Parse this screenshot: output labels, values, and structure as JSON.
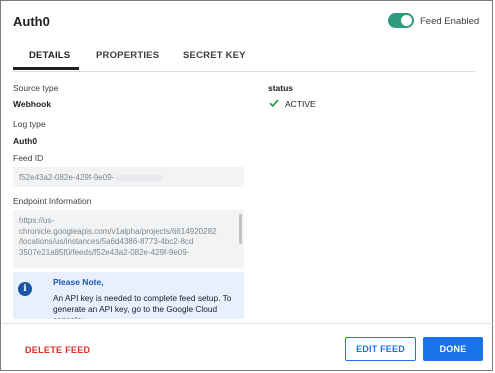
{
  "dialog": {
    "title": "Auth0",
    "feed_toggle_label": "Feed Enabled"
  },
  "tabs": [
    {
      "label": "DETAILS",
      "active": true
    },
    {
      "label": "PROPERTIES",
      "active": false
    },
    {
      "label": "SECRET KEY",
      "active": false
    }
  ],
  "details": {
    "source_type_label": "Source type",
    "source_type_value": "Webhook",
    "log_type_label": "Log type",
    "log_type_value": "Auth0",
    "feed_id_label": "Feed ID",
    "feed_id_value": "f52e43a2-082e-429f-9e09-",
    "endpoint_label": "Endpoint Information",
    "endpoint_value": "https://us-\nchronicle.googleapis.com/v1alpha/projects/6614920282\n/locations/us/instances/5a6d4386-8773-4bc2-8cd\n3507e21a85f0/feeds/f52e43a2-082e-429f-9e09-",
    "status_label": "status",
    "status_value": "ACTIVE"
  },
  "note": {
    "title": "Please Note,",
    "body": "An API key is needed to complete feed setup. To generate an API key, go to the Google Cloud console:"
  },
  "footer": {
    "delete_label": "DELETE FEED",
    "edit_label": "EDIT FEED",
    "done_label": "DONE"
  },
  "colors": {
    "accent": "#1a73e8",
    "toggle_on": "#2e9a7e",
    "danger": "#d93025",
    "status_ok": "#1e8e3e"
  }
}
